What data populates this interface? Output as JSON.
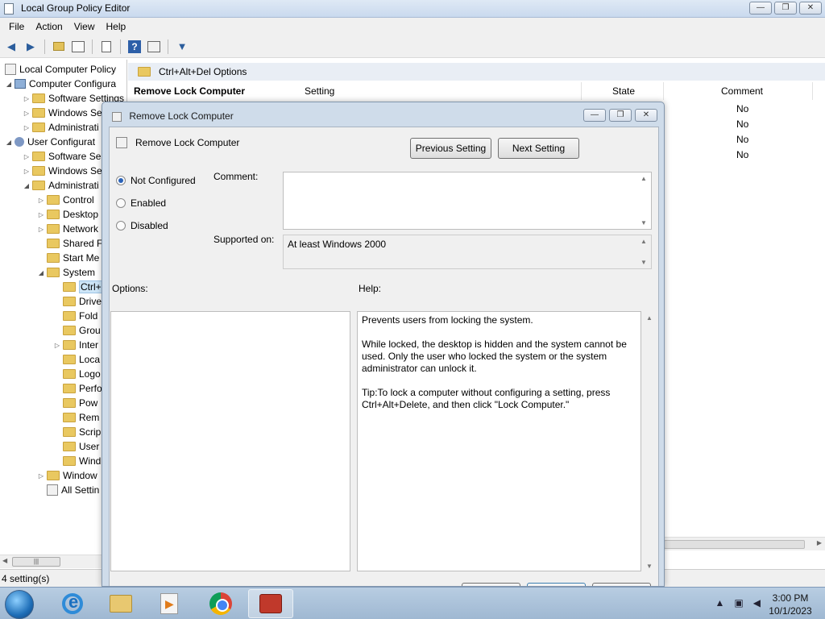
{
  "window": {
    "title": "Local Group Policy Editor",
    "controls": {
      "minimize": "—",
      "maximize": "❐",
      "close": "✕"
    }
  },
  "menu": [
    "File",
    "Action",
    "View",
    "Help"
  ],
  "tree": {
    "items": [
      {
        "label": "Local Computer Policy"
      },
      {
        "label": "Computer Configura"
      },
      {
        "label": "Software Settings"
      },
      {
        "label": "Windows Se"
      },
      {
        "label": "Administrati"
      },
      {
        "label": "User Configurat"
      },
      {
        "label": "Software Se"
      },
      {
        "label": "Windows Se"
      },
      {
        "label": "Administrati"
      },
      {
        "label": "Control"
      },
      {
        "label": "Desktop"
      },
      {
        "label": "Network"
      },
      {
        "label": "Shared F"
      },
      {
        "label": "Start Me"
      },
      {
        "label": "System"
      },
      {
        "label": "Ctrl+"
      },
      {
        "label": "Drive"
      },
      {
        "label": "Fold"
      },
      {
        "label": "Grou"
      },
      {
        "label": "Inter"
      },
      {
        "label": "Loca"
      },
      {
        "label": "Logo"
      },
      {
        "label": "Perfo"
      },
      {
        "label": "Pow"
      },
      {
        "label": "Rem"
      },
      {
        "label": "Scrip"
      },
      {
        "label": "User"
      },
      {
        "label": "Wind"
      },
      {
        "label": "Window"
      },
      {
        "label": "All Settin"
      }
    ],
    "scroll_label": "|||"
  },
  "right": {
    "breadcrumb": "Ctrl+Alt+Del Options",
    "extended_title": "Remove Lock Computer",
    "columns": {
      "setting": "Setting",
      "state": "State",
      "comment": "Comment"
    },
    "comments": [
      "No",
      "No",
      "No",
      "No"
    ]
  },
  "status": {
    "text": "4 setting(s)"
  },
  "dialog": {
    "title": "Remove Lock Computer",
    "heading": "Remove Lock Computer",
    "prev_button": "Previous Setting",
    "next_button": "Next Setting",
    "options": {
      "not_configured": "Not Configured",
      "enabled": "Enabled",
      "disabled": "Disabled",
      "selected": "not_configured"
    },
    "comment_label": "Comment:",
    "supported_label": "Supported on:",
    "supported_value": "At least Windows 2000",
    "options_label": "Options:",
    "help_label": "Help:",
    "help_text": "Prevents users from locking the system.\n\nWhile locked, the desktop is hidden and the system cannot be used. Only the user who locked the system or the system administrator can unlock it.\n\nTip:To lock a computer without configuring a setting, press Ctrl+Alt+Delete, and then click \"Lock Computer.\""
  },
  "taskbar": {
    "clock_time": "3:00 PM",
    "clock_date": "10/1/2023"
  }
}
